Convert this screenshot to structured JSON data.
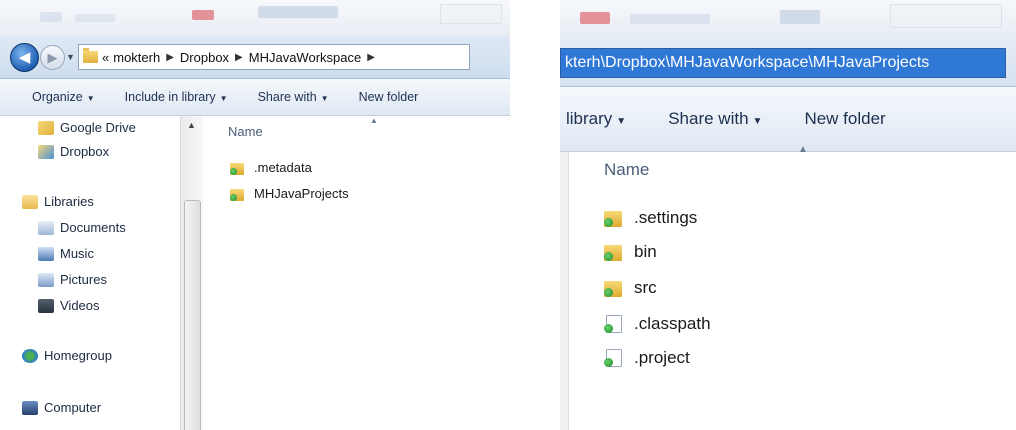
{
  "left": {
    "breadcrumb": {
      "overflow": "«",
      "items": [
        "mokterh",
        "Dropbox",
        "MHJavaWorkspace"
      ]
    },
    "toolbar": [
      {
        "label": "Organize",
        "caret": "▼"
      },
      {
        "label": "Include in library",
        "caret": "▼"
      },
      {
        "label": "Share with",
        "caret": "▼"
      },
      {
        "label": "New folder",
        "caret": ""
      }
    ],
    "nav": {
      "favorites": [
        {
          "label": "Google Drive",
          "icon": "google-drive-icon"
        },
        {
          "label": "Dropbox",
          "icon": "dropbox-icon"
        }
      ],
      "libraries": {
        "label": "Libraries",
        "icon": "libraries-icon",
        "children": [
          {
            "label": "Documents",
            "icon": "documents-icon"
          },
          {
            "label": "Music",
            "icon": "music-icon"
          },
          {
            "label": "Pictures",
            "icon": "pictures-icon"
          },
          {
            "label": "Videos",
            "icon": "videos-icon"
          }
        ]
      },
      "homegroup": {
        "label": "Homegroup",
        "icon": "homegroup-icon"
      },
      "computer": {
        "label": "Computer",
        "icon": "computer-icon"
      }
    },
    "column_header": "Name",
    "files": [
      {
        "name": ".metadata",
        "type": "folder"
      },
      {
        "name": "MHJavaProjects",
        "type": "folder"
      }
    ]
  },
  "right": {
    "address": "kterh\\Dropbox\\MHJavaWorkspace\\MHJavaProjects",
    "toolbar": [
      {
        "label": "library",
        "caret": "▼"
      },
      {
        "label": "Share with",
        "caret": "▼"
      },
      {
        "label": "New folder",
        "caret": ""
      }
    ],
    "column_header": "Name",
    "files": [
      {
        "name": ".settings",
        "type": "folder"
      },
      {
        "name": "bin",
        "type": "folder"
      },
      {
        "name": "src",
        "type": "folder"
      },
      {
        "name": ".classpath",
        "type": "file"
      },
      {
        "name": ".project",
        "type": "file"
      }
    ]
  },
  "colors": {
    "accent": "#3078d6",
    "synced": "#1b8a2a",
    "folder": "#e0b03b"
  }
}
